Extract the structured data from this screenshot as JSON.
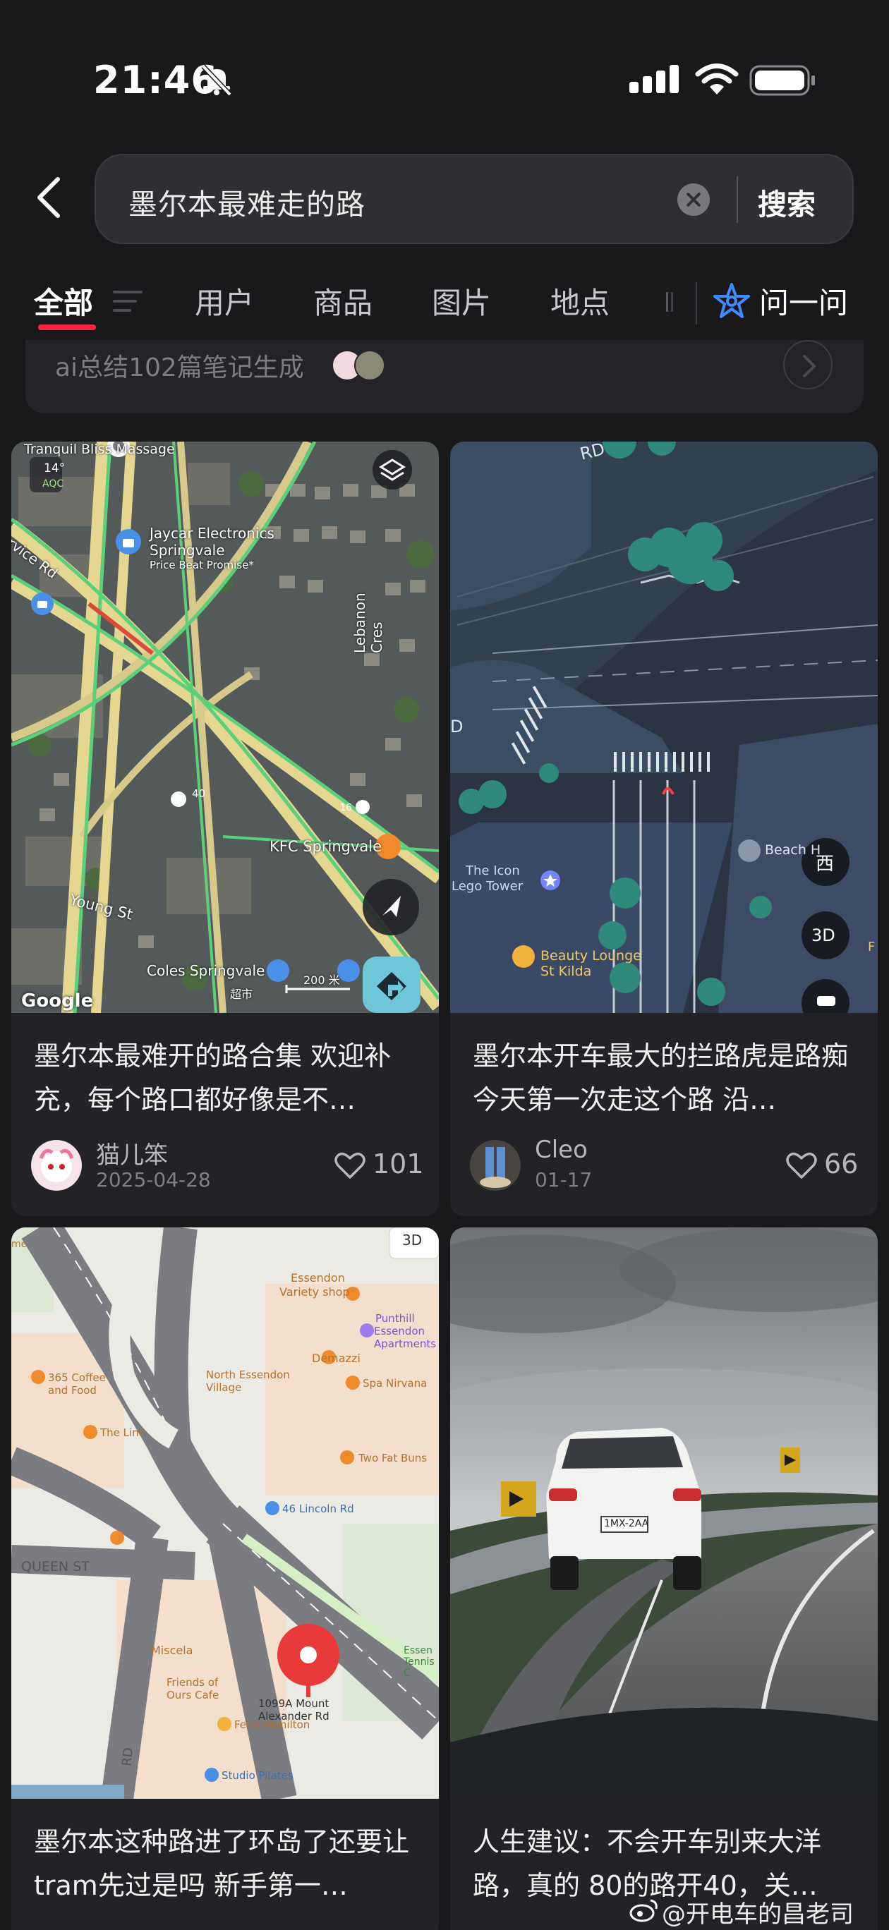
{
  "status_bar": {
    "time": "21:46"
  },
  "search": {
    "query": "墨尔本最难走的路",
    "button_label": "搜索"
  },
  "tabs": [
    {
      "label": "全部",
      "active": true
    },
    {
      "label": "用户"
    },
    {
      "label": "商品"
    },
    {
      "label": "图片"
    },
    {
      "label": "地点"
    }
  ],
  "ask_label": "问一问",
  "ai_summary": {
    "text": "ai总结102篇笔记生成"
  },
  "colors": {
    "accent": "#ff2442",
    "background": "#19191c",
    "card": "#232327",
    "ask_blue": "#3f8cff"
  },
  "cards": [
    {
      "title": "墨尔本最难开的路合集 欢迎补充，每个路口都好像是不…",
      "author": "猫儿笨",
      "date": "2025-04-28",
      "likes": "101",
      "map": {
        "weather": "14°",
        "aqi": "AQC",
        "labels": [
          "Tranquil Bliss Massage",
          "Jaycar Electronics",
          "Springvale",
          "Price Beat Promise*",
          "ervice Rd",
          "Lebanon Cres",
          "Young St",
          "KFC Springvale",
          "Coles Springvale",
          "超市",
          "200 米",
          "40",
          "16",
          "Google"
        ]
      }
    },
    {
      "title": "墨尔本开车最大的拦路虎是路痴 今天第一次走这个路 沿…",
      "author": "Cleo",
      "date": "01-17",
      "likes": "66",
      "map": {
        "labels": [
          "RD",
          "D",
          "The Icon",
          "Lego Tower",
          "Beauty Lounge",
          "St Kilda",
          "Beach H",
          "F"
        ],
        "compass": "西",
        "mode": "3D"
      }
    },
    {
      "title": "墨尔本这种路进了环岛了还要让tram先过是吗 新手第一…",
      "map": {
        "mode": "3D",
        "labels": [
          "Essendon",
          "Variety shop",
          "Punthill",
          "Essendon",
          "Apartments",
          "Demazzi",
          "365 Coffee",
          "and Food",
          "North Essendon",
          "Village",
          "Spa Nirvana",
          "The Linc",
          "Two Fat Buns",
          "46 Lincoln Rd",
          "QUEEN ST",
          "1099A Mount",
          "Alexander Rd",
          "Miscela",
          "Friends of",
          "Ours Cafe",
          "Fella Hamilton",
          "Studio Pilates",
          "Essen",
          "Tennis C",
          "RD",
          "me"
        ]
      }
    },
    {
      "title": "人生建议：不会开车别来大洋路，真的 80的路开40，关…",
      "plate": "1MX-2AA"
    }
  ],
  "watermark": "@开电车的昌老司"
}
